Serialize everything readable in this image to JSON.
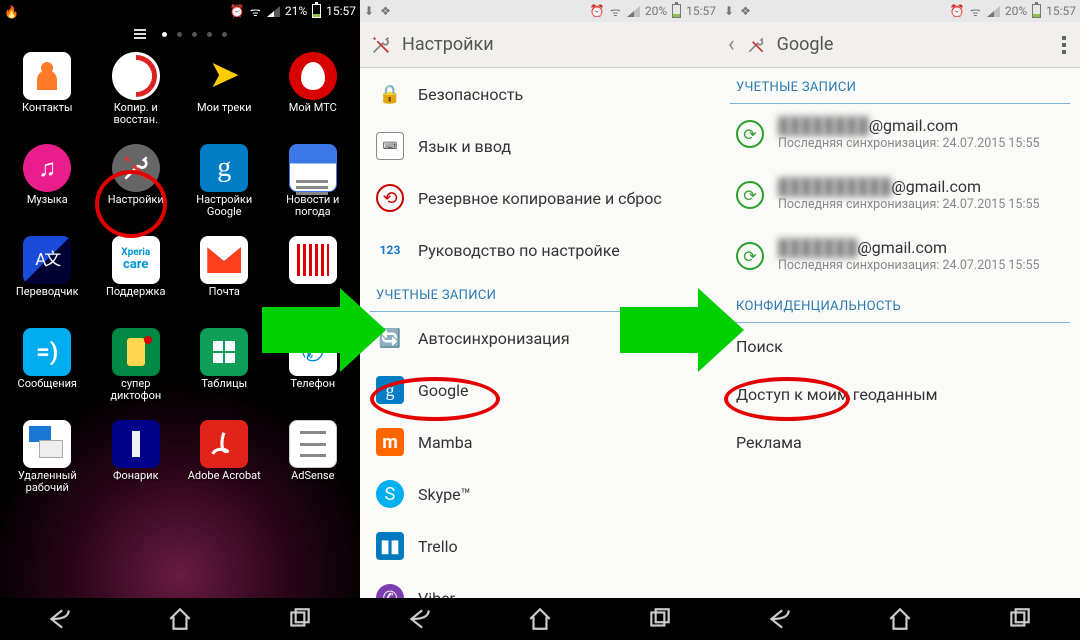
{
  "status": {
    "battery1": "21%",
    "battery2": "20%",
    "battery3": "20%",
    "time": "15:57"
  },
  "screen1": {
    "apps": [
      {
        "name": "contacts",
        "label": "Контакты"
      },
      {
        "name": "backup-restore",
        "label": "Копир. и восстан."
      },
      {
        "name": "my-tracks",
        "label": "Мои треки"
      },
      {
        "name": "my-mts",
        "label": "Мой МТС"
      },
      {
        "name": "music",
        "label": "Музыка"
      },
      {
        "name": "settings",
        "label": "Настройки"
      },
      {
        "name": "google-settings",
        "label": "Настройки Google"
      },
      {
        "name": "news-weather",
        "label": "Новости и погода"
      },
      {
        "name": "translate",
        "label": "Переводчик"
      },
      {
        "name": "support",
        "label": "Поддержка"
      },
      {
        "name": "mail",
        "label": "Почта"
      },
      {
        "name": "barcode",
        "label": ""
      },
      {
        "name": "messages",
        "label": "Сообщения"
      },
      {
        "name": "super-dictophone",
        "label": "супер диктофон"
      },
      {
        "name": "sheets",
        "label": "Таблицы"
      },
      {
        "name": "phone",
        "label": "Телефон"
      },
      {
        "name": "remote-desktop",
        "label": "Удаленный рабочий"
      },
      {
        "name": "torch",
        "label": "Фонарик"
      },
      {
        "name": "adobe-acrobat",
        "label": "Adobe Acrobat"
      },
      {
        "name": "adsense",
        "label": "AdSense"
      }
    ]
  },
  "screen2": {
    "title": "Настройки",
    "rows": {
      "security": "Безопасность",
      "language": "Язык и ввод",
      "backup": "Резервное копирование и сброс",
      "guide": "Руководство по настройке",
      "section": "УЧЕТНЫЕ ЗАПИСИ",
      "autosync": "Автосинхронизация",
      "google": "Google",
      "mamba": "Mamba",
      "skype": "Skype™",
      "trello": "Trello",
      "viber": "Viber"
    }
  },
  "screen3": {
    "title": "Google",
    "section_accounts": "УЧЕТНЫЕ ЗАПИСИ",
    "accounts": [
      {
        "email_tail": "@gmail.com",
        "sync": "Последняя синхронизация: 24.07.2015 15:55"
      },
      {
        "email_tail": "@gmail.com",
        "sync": "Последняя синхронизация: 24.07.2015 15:55"
      },
      {
        "email_tail": "@gmail.com",
        "sync": "Последняя синхронизация: 24.07.2015 15:55"
      }
    ],
    "section_privacy": "КОНФИДЕНЦИАЛЬНОСТЬ",
    "privacy": {
      "search": "Поиск",
      "location": "Доступ к моим геоданным",
      "ads": "Реклама"
    }
  }
}
